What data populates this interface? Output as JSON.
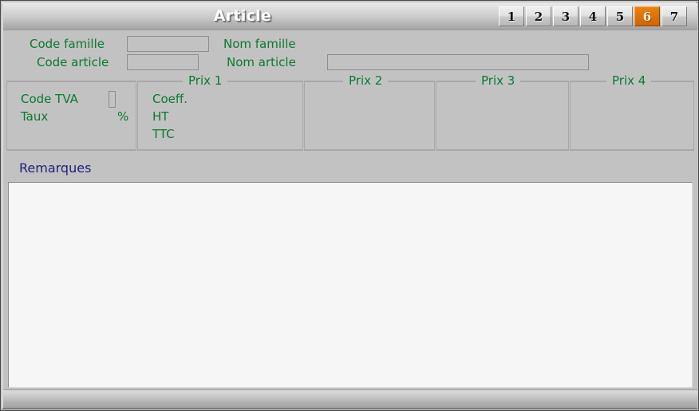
{
  "window": {
    "title": "Article"
  },
  "tabs": [
    {
      "label": "1",
      "active": false
    },
    {
      "label": "2",
      "active": false
    },
    {
      "label": "3",
      "active": false
    },
    {
      "label": "4",
      "active": false
    },
    {
      "label": "5",
      "active": false
    },
    {
      "label": "6",
      "active": true
    },
    {
      "label": "7",
      "active": false
    }
  ],
  "header": {
    "code_famille_label": "Code famille",
    "code_famille_value": "",
    "nom_famille_label": "Nom famille",
    "nom_famille_value": "",
    "code_article_label": "Code article",
    "code_article_value": "",
    "nom_article_label": "Nom article",
    "nom_article_value": ""
  },
  "tva_panel": {
    "code_tva_label": "Code TVA",
    "code_tva_value": "",
    "taux_label": "Taux",
    "taux_value": "",
    "percent_symbol": "%"
  },
  "price_panels": [
    {
      "legend": "Prix 1",
      "rows": [
        {
          "label": "Coeff.",
          "value": ""
        },
        {
          "label": "HT",
          "value": ""
        },
        {
          "label": "TTC",
          "value": ""
        }
      ]
    },
    {
      "legend": "Prix 2",
      "rows": []
    },
    {
      "legend": "Prix 3",
      "rows": []
    },
    {
      "legend": "Prix 4",
      "rows": []
    }
  ],
  "remarks": {
    "label": "Remarques",
    "value": ""
  },
  "colors": {
    "accent_orange": "#dd7208",
    "label_green": "#0a7a30",
    "remarks_blue": "#202080",
    "window_gray": "#c2c2c2"
  }
}
